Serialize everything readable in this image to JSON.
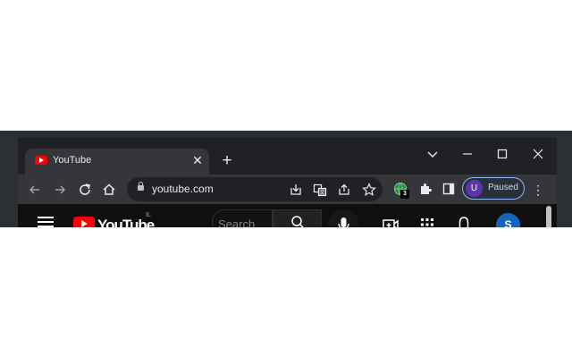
{
  "browser": {
    "tab": {
      "title": "YouTube",
      "close_icon": "close-icon",
      "favicon": "youtube-favicon"
    },
    "new_tab_icon": "plus-icon",
    "window_controls": [
      "chevron-down-icon",
      "minimize-icon",
      "maximize-icon",
      "close-icon"
    ],
    "toolbar": {
      "back_icon": "arrow-left-icon",
      "forward_icon": "arrow-right-icon",
      "reload_icon": "reload-icon",
      "home_icon": "home-icon",
      "address": "youtube.com",
      "omnibox_actions": [
        "install-icon",
        "translate-icon",
        "share-icon",
        "star-icon"
      ],
      "extension_badge": "3",
      "profile": {
        "initial": "U",
        "label": "Paused"
      }
    }
  },
  "page": {
    "logo_text": "YouTube",
    "country_code": "IL",
    "search_placeholder": "Search",
    "avatar_initial": "S"
  },
  "colors": {
    "tab_bg": "#35363a",
    "window_bg": "#202124",
    "profile_accent": "#8ab4f8",
    "yt_red": "#ff0000"
  }
}
